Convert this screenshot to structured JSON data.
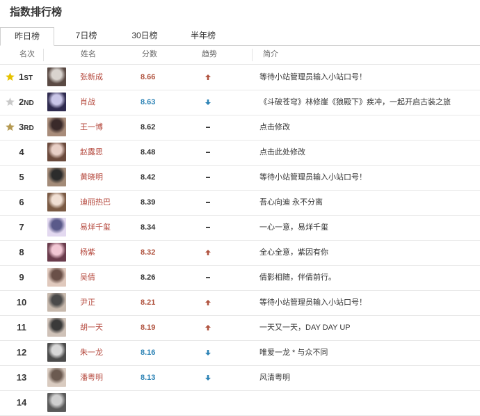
{
  "page_title": "指数排行榜",
  "tabs": [
    {
      "label": "昨日榜",
      "active": true
    },
    {
      "label": "7日榜",
      "active": false
    },
    {
      "label": "30日榜",
      "active": false
    },
    {
      "label": "半年榜",
      "active": false
    }
  ],
  "columns": {
    "rank": "名次",
    "name": "姓名",
    "score": "分数",
    "trend": "趋势",
    "intro": "简介"
  },
  "colors": {
    "up": "#b0533f",
    "down": "#2d83b5",
    "name": "#b5493e",
    "gold": "#e6c200",
    "silver": "#c9c9c9",
    "bronze": "#b59a52"
  },
  "rows": [
    {
      "rank": "1",
      "suffix": "ST",
      "medal": "gold",
      "name": "张新成",
      "score": "8.66",
      "trend": "up",
      "intro": "等待小站管理员输入小站口号！"
    },
    {
      "rank": "2",
      "suffix": "ND",
      "medal": "silver",
      "name": "肖战",
      "score": "8.63",
      "trend": "down",
      "intro": "《斗破苍穹》林修崖《狼殿下》疾冲，一起开启古装之旅"
    },
    {
      "rank": "3",
      "suffix": "RD",
      "medal": "bronze",
      "name": "王一博",
      "score": "8.62",
      "trend": "flat",
      "intro": "点击修改"
    },
    {
      "rank": "4",
      "suffix": "",
      "medal": "",
      "name": "赵露思",
      "score": "8.48",
      "trend": "flat",
      "intro": "点击此处修改"
    },
    {
      "rank": "5",
      "suffix": "",
      "medal": "",
      "name": "黄晓明",
      "score": "8.42",
      "trend": "flat",
      "intro": "等待小站管理员输入小站口号！"
    },
    {
      "rank": "6",
      "suffix": "",
      "medal": "",
      "name": "迪丽热巴",
      "score": "8.39",
      "trend": "flat",
      "intro": "吾心向迪 永不分离"
    },
    {
      "rank": "7",
      "suffix": "",
      "medal": "",
      "name": "易烊千玺",
      "score": "8.34",
      "trend": "flat",
      "intro": "一心一意，易烊千玺"
    },
    {
      "rank": "8",
      "suffix": "",
      "medal": "",
      "name": "杨紫",
      "score": "8.32",
      "trend": "up",
      "intro": "全心全意，紫因有你"
    },
    {
      "rank": "9",
      "suffix": "",
      "medal": "",
      "name": "吴倩",
      "score": "8.26",
      "trend": "flat",
      "intro": "倩影相随，伴倩前行。"
    },
    {
      "rank": "10",
      "suffix": "",
      "medal": "",
      "name": "尹正",
      "score": "8.21",
      "trend": "up",
      "intro": "等待小站管理员输入小站口号！"
    },
    {
      "rank": "11",
      "suffix": "",
      "medal": "",
      "name": "胡一天",
      "score": "8.19",
      "trend": "up",
      "intro": "一天又一天，DAY DAY UP"
    },
    {
      "rank": "12",
      "suffix": "",
      "medal": "",
      "name": "朱一龙",
      "score": "8.16",
      "trend": "down",
      "intro": "唯爱一龙 * 与众不同"
    },
    {
      "rank": "13",
      "suffix": "",
      "medal": "",
      "name": "潘粤明",
      "score": "8.13",
      "trend": "down",
      "intro": "风清粤明"
    },
    {
      "rank": "14",
      "suffix": "",
      "medal": "",
      "name": "",
      "score": "",
      "trend": "",
      "intro": ""
    }
  ]
}
